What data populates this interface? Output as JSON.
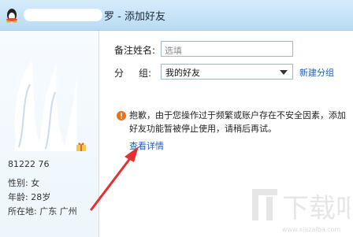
{
  "titlebar": {
    "title": "罗 - 添加好友"
  },
  "profile": {
    "qq_number": "81222 76",
    "gender": "性别: 女",
    "age": "年龄: 28岁",
    "location": "所在地: 广东 广州"
  },
  "form": {
    "remark_label": "备注姓名:",
    "remark_placeholder": "选填",
    "group_label_a": "分",
    "group_label_b": "组:",
    "group_value": "我的好友",
    "new_group_link": "新建分组"
  },
  "notice": {
    "message": "抱歉，由于您操作过于频繁或账户存在不安全因素，添加好友功能暂被停止使用，请稍后再试。",
    "details_link": "查看详情"
  },
  "watermark": {
    "text": "下载吧",
    "url": "www.xiazaiba.com"
  },
  "colors": {
    "accent_link": "#1a5fbf",
    "arrow": "#e53030",
    "warning": "#e8731a"
  }
}
